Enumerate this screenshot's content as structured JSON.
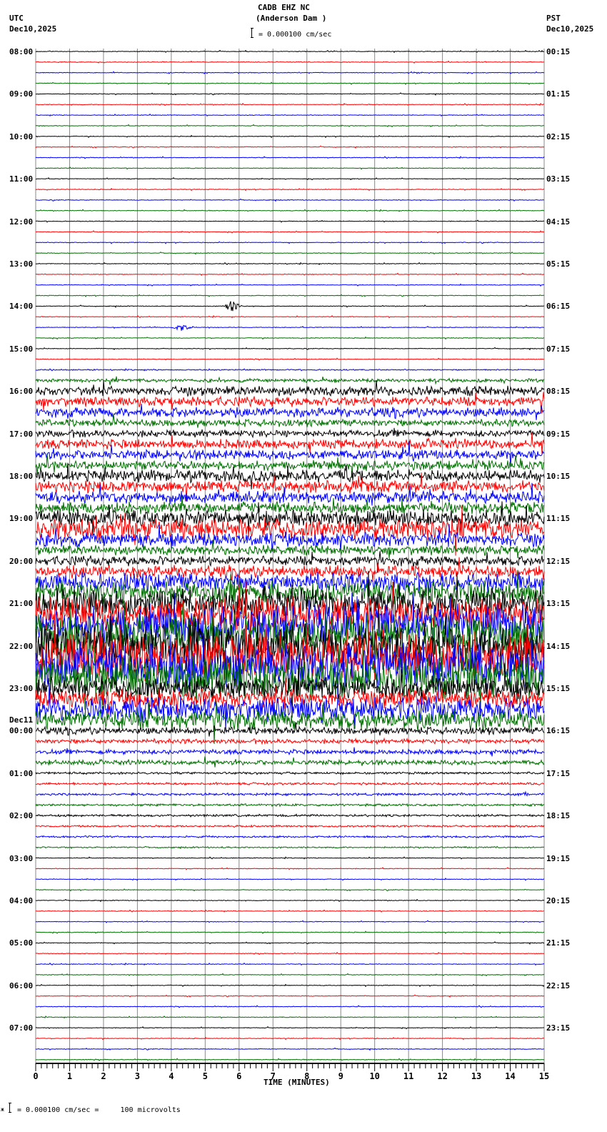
{
  "header": {
    "title": "CADB EHZ NC",
    "subtitle": "(Anderson Dam )",
    "left_tz": "UTC",
    "left_date": "Dec10,2025",
    "right_tz": "PST",
    "right_date": "Dec10,2025",
    "scale": "= 0.000100 cm/sec"
  },
  "footer": {
    "scale": "= 0.000100 cm/sec =     100 microvolts",
    "mark": "ж"
  },
  "chart_data": {
    "type": "line",
    "title": "CADB EHZ NC (Anderson Dam )",
    "xlabel": "TIME (MINUTES)",
    "xlim": [
      0,
      15
    ],
    "x_ticks": [
      "0",
      "1",
      "2",
      "3",
      "4",
      "5",
      "6",
      "7",
      "8",
      "9",
      "10",
      "11",
      "12",
      "13",
      "14",
      "15"
    ],
    "row_minutes": 15,
    "colors": [
      "#000000",
      "#ff0000",
      "#0000ff",
      "#007000"
    ],
    "left_labels": [
      "08:00",
      "09:00",
      "10:00",
      "11:00",
      "12:00",
      "13:00",
      "14:00",
      "15:00",
      "16:00",
      "17:00",
      "18:00",
      "19:00",
      "20:00",
      "21:00",
      "22:00",
      "23:00",
      "00:00",
      "01:00",
      "02:00",
      "03:00",
      "04:00",
      "05:00",
      "06:00",
      "07:00"
    ],
    "left_day_label": "Dec11",
    "right_labels": [
      "00:15",
      "01:15",
      "02:15",
      "03:15",
      "04:15",
      "05:15",
      "06:15",
      "07:15",
      "08:15",
      "09:15",
      "10:15",
      "11:15",
      "12:15",
      "13:15",
      "14:15",
      "15:15",
      "16:15",
      "17:15",
      "18:15",
      "19:15",
      "20:15",
      "21:15",
      "22:15",
      "23:15"
    ],
    "row_activity": [
      0.3,
      0.3,
      0.3,
      0.3,
      0.3,
      0.3,
      0.3,
      0.3,
      0.3,
      0.3,
      0.3,
      0.3,
      0.3,
      0.3,
      0.3,
      0.3,
      0.3,
      0.3,
      0.3,
      0.3,
      0.3,
      0.3,
      0.3,
      0.3,
      0.3,
      0.3,
      0.3,
      0.3,
      0.3,
      0.3,
      0.5,
      1.5,
      4,
      4,
      4,
      3,
      3,
      4,
      4,
      4,
      5,
      5,
      5,
      5,
      7,
      9,
      6,
      4,
      4,
      5,
      8,
      10,
      12,
      14,
      16,
      18,
      18,
      20,
      20,
      18,
      10,
      8,
      10,
      8,
      3,
      2,
      2,
      2,
      1,
      1,
      1,
      1,
      1,
      0.8,
      0.8,
      0.6,
      0.3,
      0.3,
      0.3,
      0.3,
      0.3,
      0.3,
      0.3,
      0.3,
      0.3,
      0.3,
      0.3,
      0.3,
      0.3,
      0.3,
      0.3,
      0.3,
      0.3,
      0.3,
      0.3,
      0.3
    ],
    "events": [
      {
        "row": 24,
        "minute": 5.8,
        "amp": 8
      },
      {
        "row": 26,
        "minute": 4.3,
        "amp": 5
      },
      {
        "row": 70,
        "minute": 12.5,
        "amp": 3
      },
      {
        "row": 70,
        "minute": 14.5,
        "amp": 3
      }
    ]
  }
}
